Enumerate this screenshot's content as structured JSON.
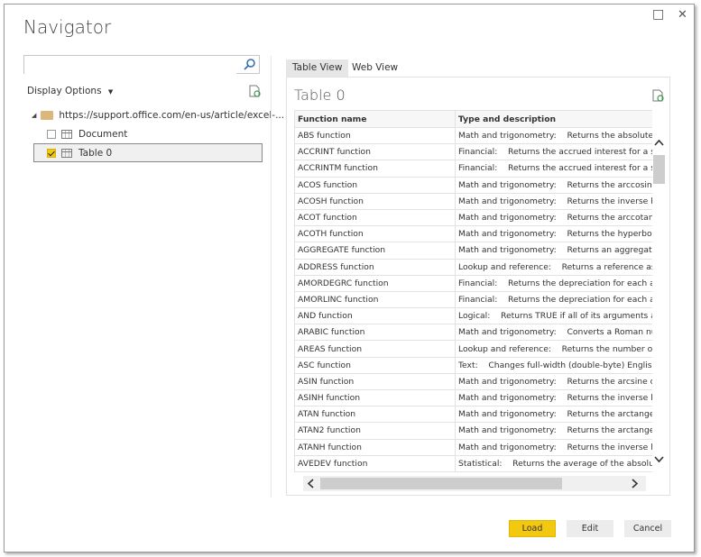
{
  "window": {
    "title": "Navigator",
    "maximize_icon": "□",
    "close_icon": "✕"
  },
  "left": {
    "search_placeholder": "",
    "display_options": "Display Options",
    "tree": {
      "root": "https://support.office.com/en-us/article/excel-...",
      "items": [
        {
          "label": "Document",
          "checked": false
        },
        {
          "label": "Table 0",
          "checked": true,
          "selected": true
        }
      ]
    }
  },
  "tabs": [
    {
      "label": "Table View",
      "active": true
    },
    {
      "label": "Web View",
      "active": false
    }
  ],
  "preview": {
    "title": "Table 0",
    "columns": [
      "Function name",
      "Type and description"
    ],
    "rows": [
      [
        "ABS function",
        "Math and trigonometry:    Returns the absolute val"
      ],
      [
        "ACCRINT function",
        "Financial:    Returns the accrued interest for a secur"
      ],
      [
        "ACCRINTM function",
        "Financial:    Returns the accrued interest for a secur"
      ],
      [
        "ACOS function",
        "Math and trigonometry:    Returns the arccosine of"
      ],
      [
        "ACOSH function",
        "Math and trigonometry:    Returns the inverse hype"
      ],
      [
        "ACOT function",
        "Math and trigonometry:    Returns the arccotangen"
      ],
      [
        "ACOTH function",
        "Math and trigonometry:    Returns the hyperbolic a"
      ],
      [
        "AGGREGATE function",
        "Math and trigonometry:    Returns an aggregate in"
      ],
      [
        "ADDRESS function",
        "Lookup and reference:    Returns a reference as tex"
      ],
      [
        "AMORDEGRC function",
        "Financial:    Returns the depreciation for each accou"
      ],
      [
        "AMORLINC function",
        "Financial:    Returns the depreciation for each accou"
      ],
      [
        "AND function",
        "Logical:    Returns TRUE if all of its arguments are TI"
      ],
      [
        "ARABIC function",
        "Math and trigonometry:    Converts a Roman numb"
      ],
      [
        "AREAS function",
        "Lookup and reference:    Returns the number of are"
      ],
      [
        "ASC function",
        "Text:    Changes full-width (double-byte) English let"
      ],
      [
        "ASIN function",
        "Math and trigonometry:    Returns the arcsine of a"
      ],
      [
        "ASINH function",
        "Math and trigonometry:    Returns the inverse hype"
      ],
      [
        "ATAN function",
        "Math and trigonometry:    Returns the arctangent c"
      ],
      [
        "ATAN2 function",
        "Math and trigonometry:    Returns the arctangent f"
      ],
      [
        "ATANH function",
        "Math and trigonometry:    Returns the inverse hype"
      ],
      [
        "AVEDEV function",
        "Statistical:    Returns the average of the absolute de"
      ],
      [
        "",
        ""
      ]
    ]
  },
  "buttons": {
    "load": "Load",
    "edit": "Edit",
    "cancel": "Cancel"
  },
  "colors": {
    "accent": "#f2c811",
    "folder": "#dcb67a"
  }
}
